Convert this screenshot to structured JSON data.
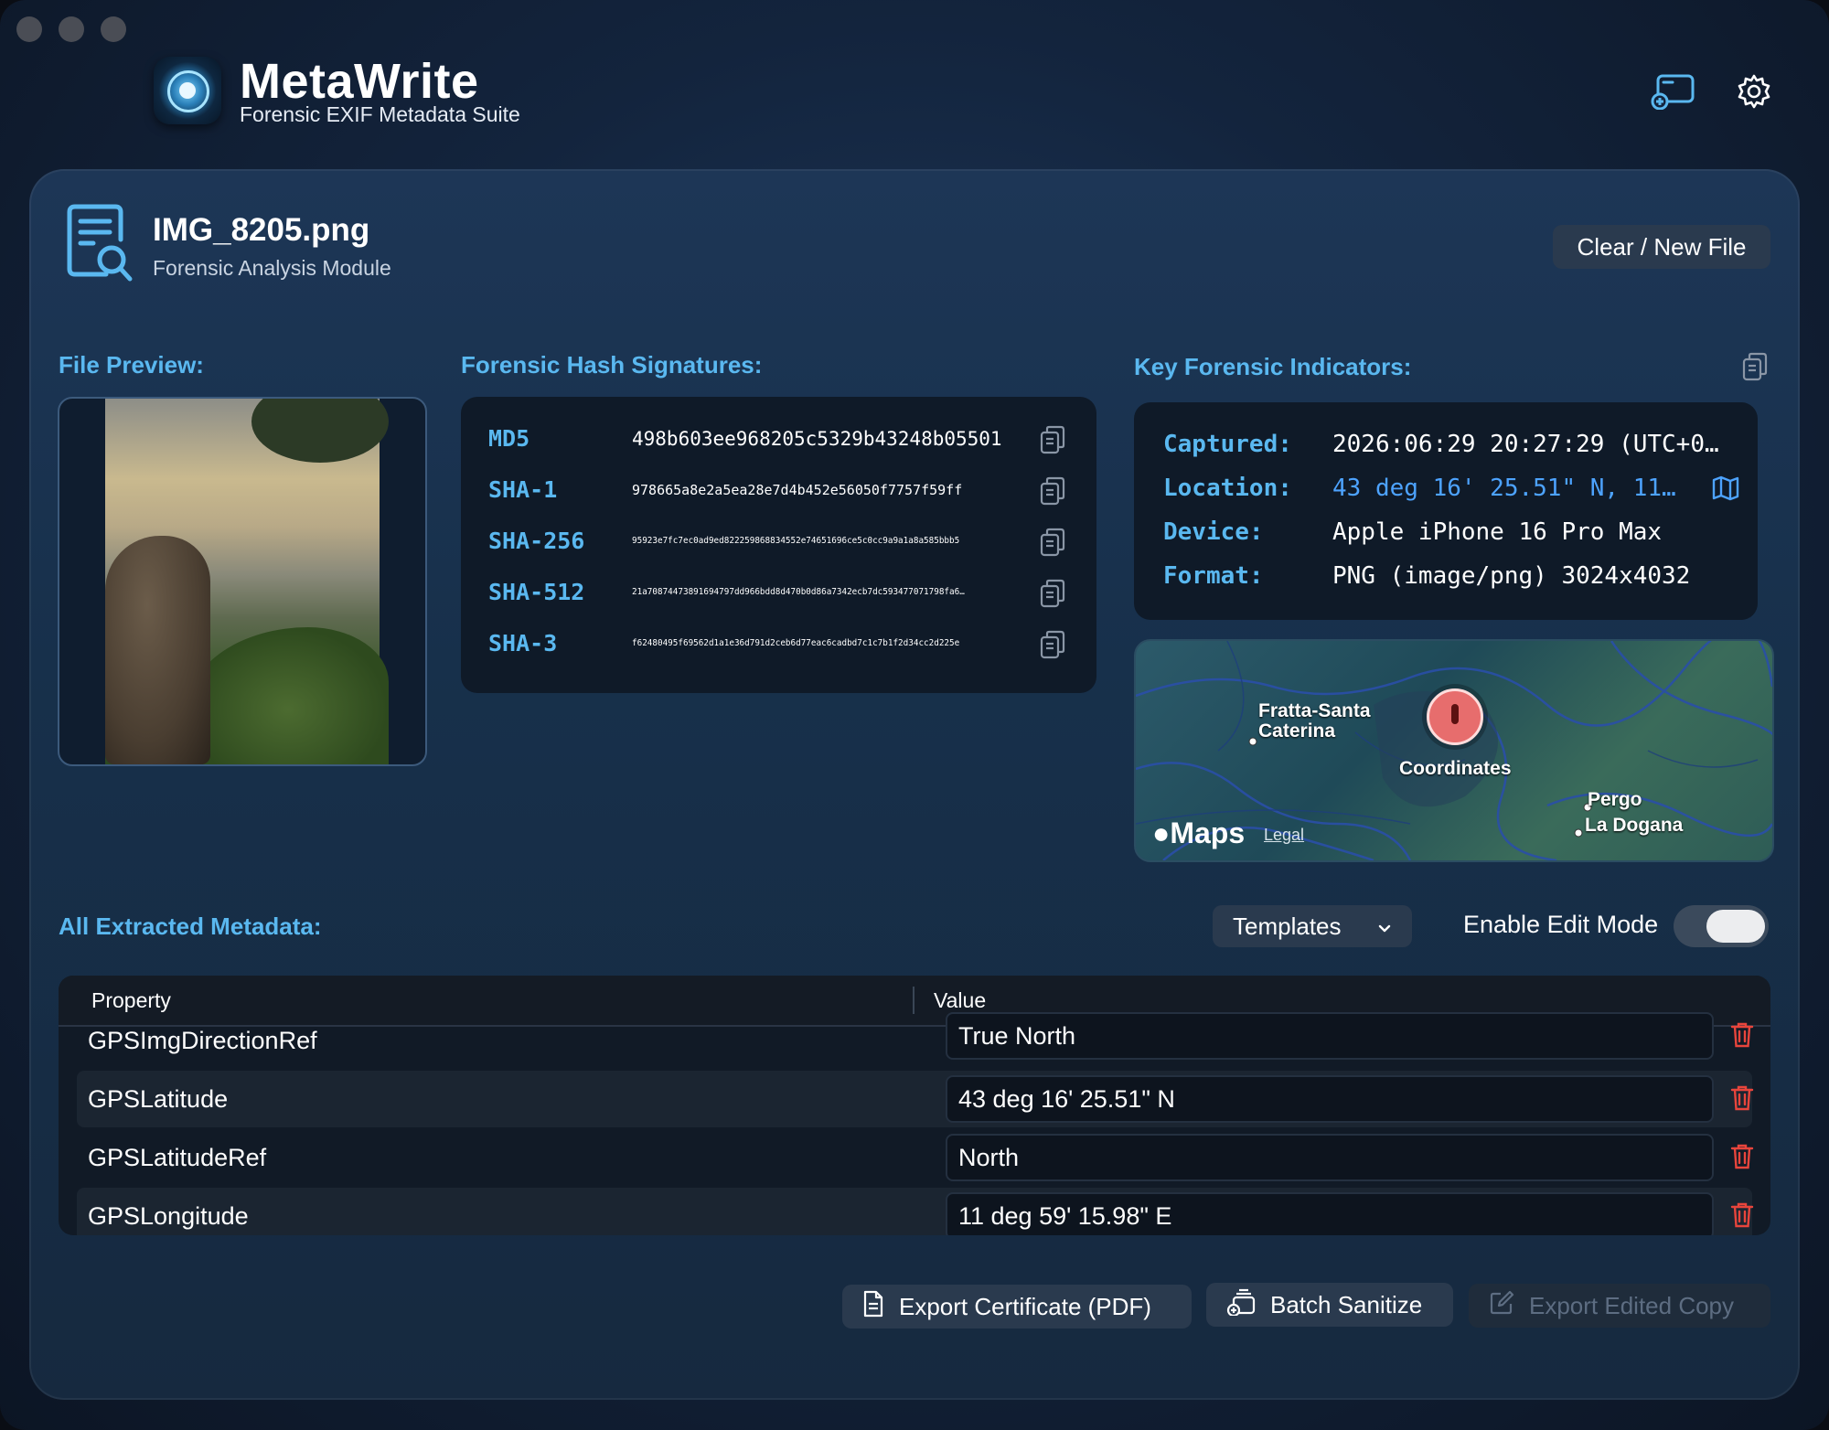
{
  "app": {
    "title": "MetaWrite",
    "subtitle": "Forensic EXIF Metadata Suite"
  },
  "file": {
    "name": "IMG_8205.png",
    "module": "Forensic Analysis Module",
    "clear_label": "Clear / New File"
  },
  "sections": {
    "preview": "File Preview:",
    "hashes": "Forensic Hash Signatures:",
    "indicators": "Key Forensic Indicators:",
    "metadata": "All Extracted Metadata:"
  },
  "hashes": [
    {
      "name": "MD5",
      "value": "498b603ee968205c5329b43248b05501"
    },
    {
      "name": "SHA-1",
      "value": "978665a8e2a5ea28e7d4b452e56050f7757f59ff"
    },
    {
      "name": "SHA-256",
      "value": "95923e7fc7ec0ad9ed822259868834552e74651696ce5c0cc9a9a1a8a585bbb5"
    },
    {
      "name": "SHA-512",
      "value": "21a70874473891694797dd966bdd8d470b0d86a7342ecb7dc593477071798fa6…"
    },
    {
      "name": "SHA-3",
      "value": "f62480495f69562d1a1e36d791d2ceb6d77eac6cadbd7c1c7b1f2d34cc2d225e"
    }
  ],
  "indicators": {
    "captured": {
      "label": "Captured:",
      "value": "2026:06:29 20:27:29 (UTC+0…"
    },
    "location": {
      "label": "Location:",
      "value": "43 deg 16' 25.51\" N, 11…"
    },
    "device": {
      "label": "Device:",
      "value": "Apple iPhone 16 Pro Max"
    },
    "format": {
      "label": "Format:",
      "value": "PNG (image/png) 3024x4032"
    }
  },
  "map": {
    "places": [
      "Fratta-Santa Caterina",
      "Pergo",
      "La Dogana"
    ],
    "pin_label": "Coordinates",
    "brand": "Maps",
    "legal": "Legal"
  },
  "controls": {
    "templates_label": "Templates",
    "edit_mode_label": "Enable Edit Mode",
    "edit_mode_on": true
  },
  "table": {
    "headers": [
      "Property",
      "Value"
    ],
    "rows": [
      {
        "property": "GPSImgDirectionRef",
        "value": "True North"
      },
      {
        "property": "GPSLatitude",
        "value": "43 deg 16' 25.51\" N"
      },
      {
        "property": "GPSLatitudeRef",
        "value": "North"
      },
      {
        "property": "GPSLongitude",
        "value": "11 deg 59' 15.98\" E"
      }
    ]
  },
  "actions": {
    "export_pdf": "Export Certificate (PDF)",
    "batch_sanitize": "Batch Sanitize",
    "export_edited": "Export Edited Copy"
  },
  "colors": {
    "accent": "#5ab8f0",
    "danger": "#e8453c",
    "link": "#4da3ff"
  }
}
